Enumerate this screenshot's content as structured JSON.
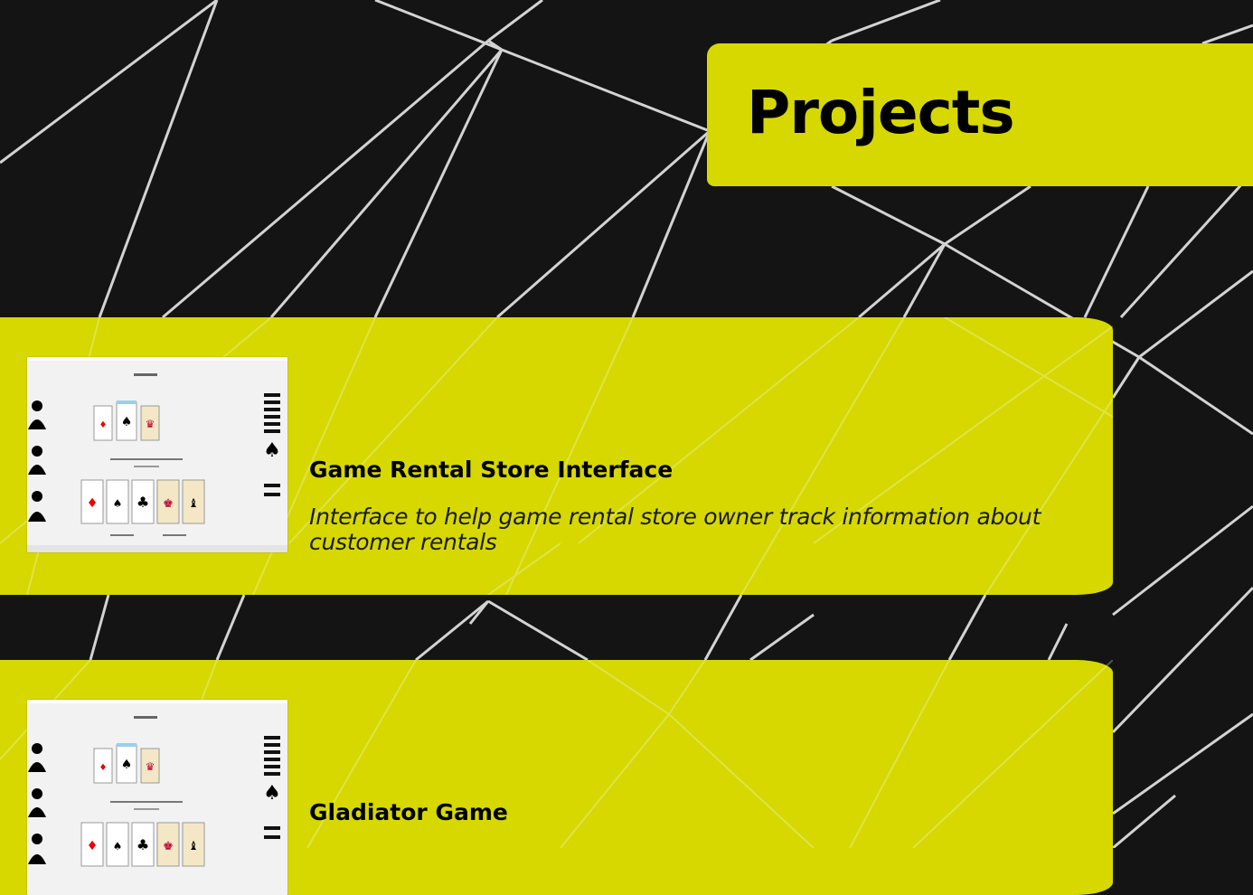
{
  "header": {
    "title": "Projects"
  },
  "projects": [
    {
      "title": "Game Rental Store Interface",
      "description": "Interface to help game rental store owner track information about customer rentals",
      "thumbnail_icon": "card-game-screenshot-thumbnail"
    },
    {
      "title": "Gladiator Game",
      "description": "",
      "thumbnail_icon": "card-game-screenshot-thumbnail"
    }
  ],
  "colors": {
    "accent": "#d6d800",
    "background": "#141414",
    "lines": "#ffffff"
  }
}
